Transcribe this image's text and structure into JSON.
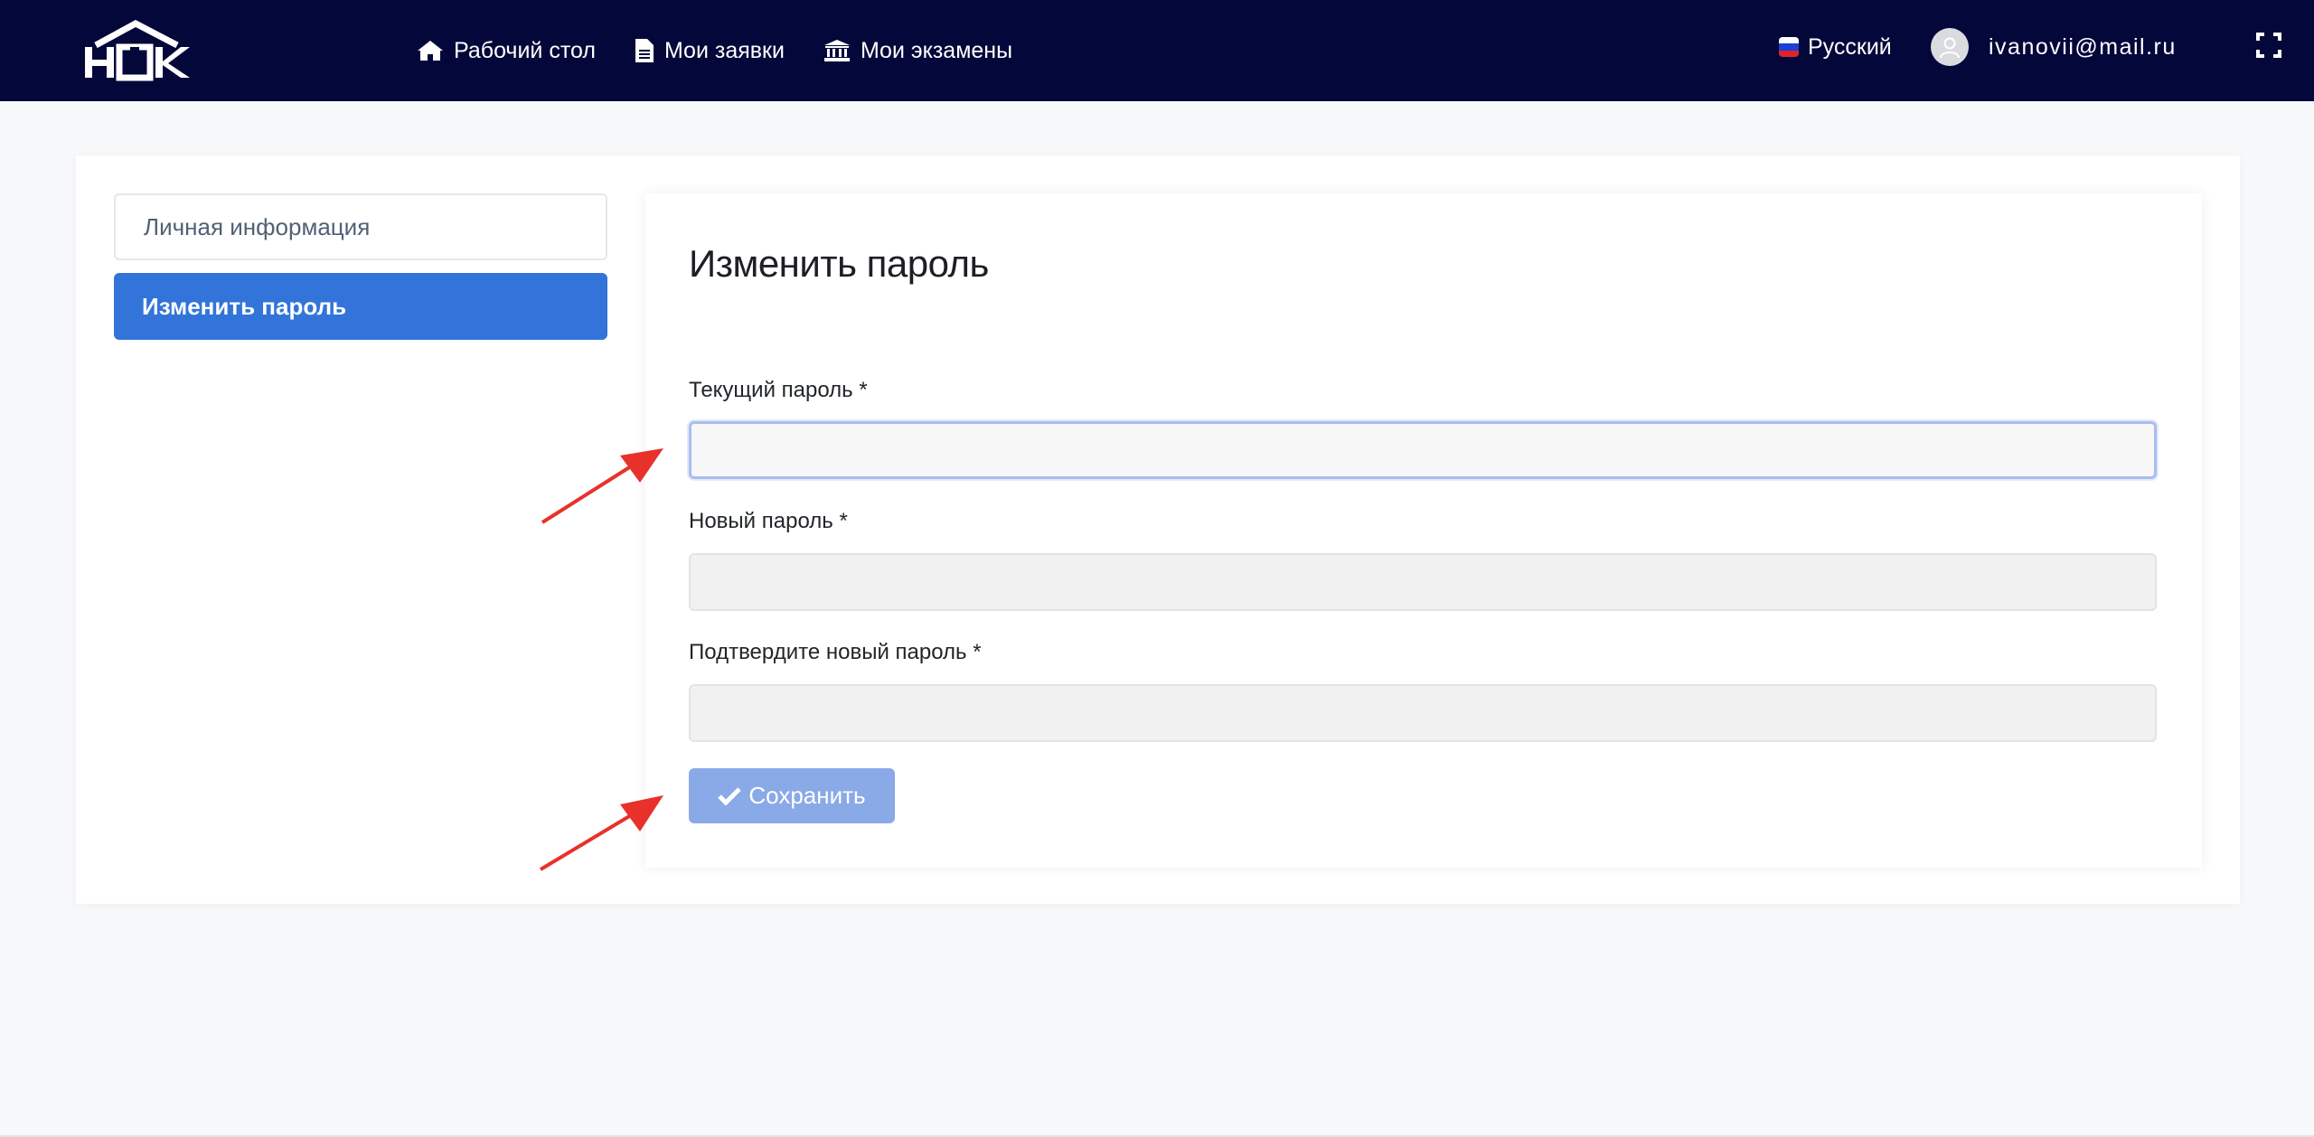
{
  "header": {
    "logo_text": "НОК",
    "nav": [
      {
        "label": "Рабочий стол",
        "icon": "home-icon"
      },
      {
        "label": "Мои заявки",
        "icon": "document-icon"
      },
      {
        "label": "Мои экзамены",
        "icon": "institution-icon"
      }
    ],
    "language": {
      "label": "Русский",
      "icon": "russia-flag-icon"
    },
    "user": {
      "email": "ivanovii@mail.ru",
      "icon": "user-avatar-icon"
    },
    "fullscreen_icon": "expand-icon"
  },
  "sidebar": {
    "items": [
      {
        "label": "Личная информация",
        "active": false
      },
      {
        "label": "Изменить пароль",
        "active": true
      }
    ]
  },
  "form": {
    "title": "Изменить пароль",
    "fields": [
      {
        "label": "Текущий пароль *",
        "value": "",
        "focused": true
      },
      {
        "label": "Новый пароль *",
        "value": ""
      },
      {
        "label": "Подтвердите новый пароль *",
        "value": ""
      }
    ],
    "save_label": "Сохранить",
    "save_icon": "check-icon"
  },
  "colors": {
    "navbar": "#03073a",
    "accent": "#3274d9",
    "button_disabled": "#8aa9e7",
    "annotation_arrow": "#e8312b"
  }
}
